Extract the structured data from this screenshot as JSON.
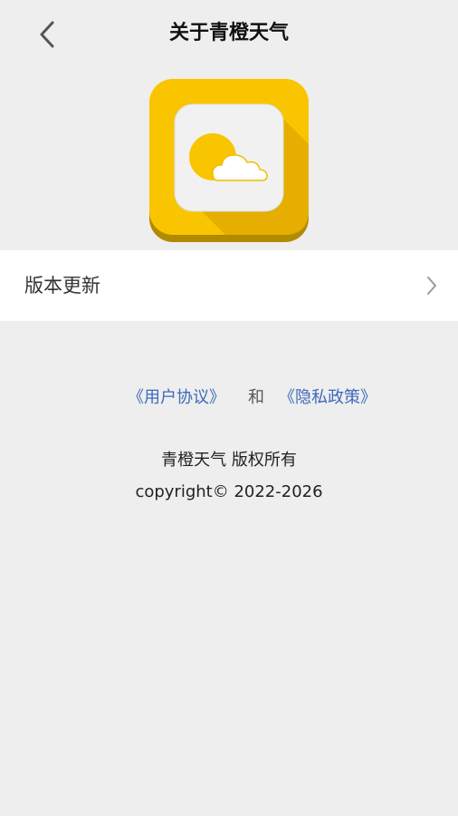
{
  "header": {
    "title": "关于青橙天气",
    "back_icon": "chevron-left-icon"
  },
  "app": {
    "logo_icon": "sun-cloud-icon",
    "brand_color": "#F9C500"
  },
  "settings": {
    "update_label": "版本更新",
    "chevron_icon": "chevron-right-icon"
  },
  "legal": {
    "user_agreement": "《用户协议》",
    "and": "和",
    "privacy_policy": "《隐私政策》",
    "link_color": "#3d6ab8"
  },
  "footer": {
    "rights": "青橙天气  版权所有",
    "copyright": "copyright© 2022-2026"
  }
}
